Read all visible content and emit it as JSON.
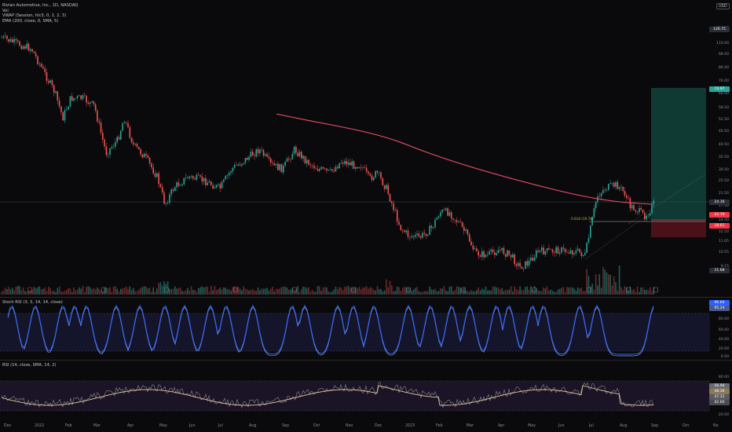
{
  "legend": {
    "symbol": "Rivian Automotive, Inc., 1D, NASDAQ",
    "vol": "Vol",
    "vwap": "VWAP (Session, hlc3, 0, 1, 2, 3)",
    "ema": "EMA (200, close, 0, SMA, 5)"
  },
  "currency": "USD",
  "price_scale": [
    "126.75",
    "110.00",
    "98.00",
    "86.00",
    "76.00",
    "66.00",
    "58.50",
    "52.50",
    "46.50",
    "40.50",
    "35.50",
    "30.50",
    "25.50",
    "21.50",
    "17.50",
    "14.50",
    "12.50",
    "11.65",
    "10.55",
    "9.15"
  ],
  "price_tags": [
    {
      "label": "High",
      "value": "126.75",
      "color": "#2a2e39"
    },
    {
      "label": "target",
      "value": "74.97",
      "color": "#26a69a"
    },
    {
      "label": "last",
      "value": "24.16",
      "color": "#2a2e39"
    },
    {
      "label": "entry",
      "value": "22.70",
      "color": "#f23645"
    },
    {
      "label": "stop",
      "value": "18.61",
      "color": "#f23645"
    },
    {
      "label": "Low",
      "value": "11.68",
      "color": "#2a2e39"
    }
  ],
  "fib_label": "0.618 (19.78)",
  "stoch_rsi": {
    "title": "Stoch RSI (3, 3, 14, 14, close)",
    "scale": [
      "100.00",
      "80.00",
      "60.00",
      "40.00",
      "20.00",
      "0.00"
    ],
    "tags": [
      "96.64",
      "95.24"
    ]
  },
  "rsi": {
    "title": "RSI (14, close, SMA, 14, 2)",
    "scale": [
      "80.00",
      "60.00",
      "40.00",
      "20.00"
    ],
    "tags": [
      "56.94",
      "48.36",
      "47.31",
      "42.60"
    ]
  },
  "time_axis": [
    "Dec",
    "2022",
    "Feb",
    "Mar",
    "Apr",
    "May",
    "Jun",
    "Jul",
    "Aug",
    "Sep",
    "Oct",
    "Nov",
    "Dec",
    "2023",
    "Feb",
    "Mar",
    "Apr",
    "May",
    "Jun",
    "Jul",
    "Aug",
    "Sep",
    "Oct",
    "No"
  ],
  "colors": {
    "up": "#26a69a",
    "down": "#ef5350",
    "ema": "#f0506e",
    "stoch": "#2962ff",
    "rsi_ma": "#e8c796"
  }
}
